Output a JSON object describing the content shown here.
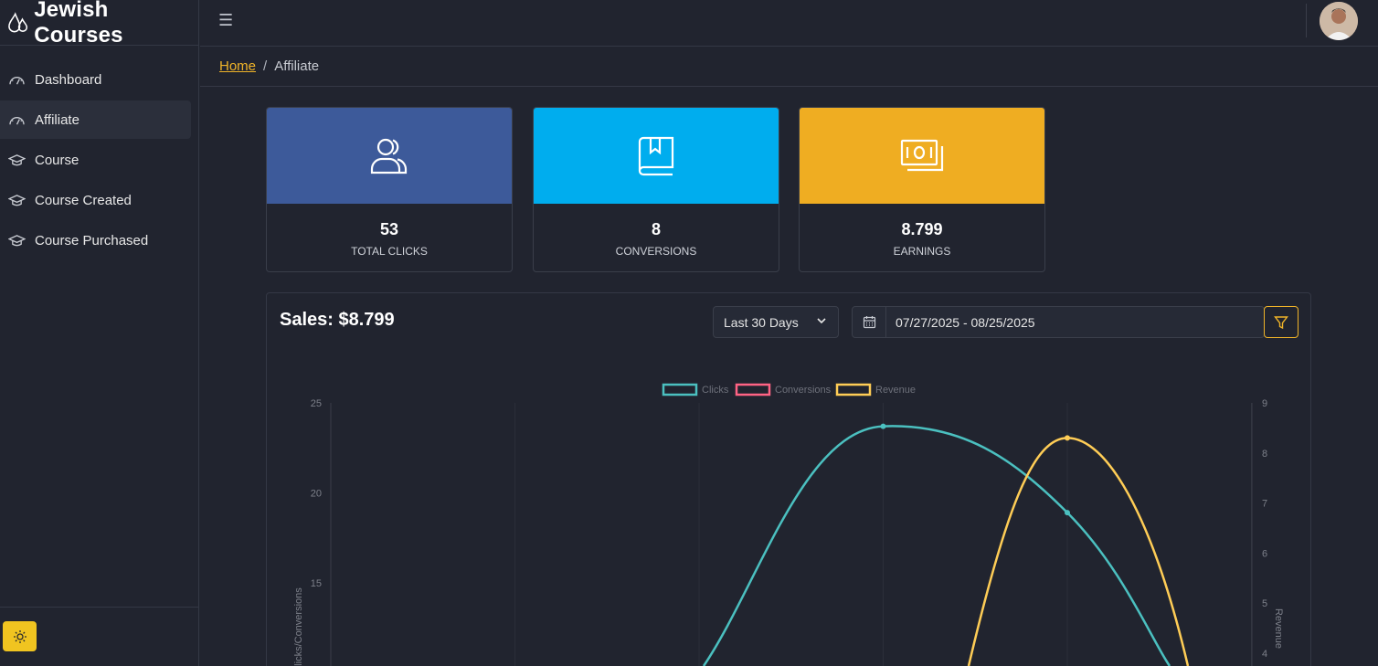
{
  "brand": {
    "name": "Jewish Courses"
  },
  "sidebar": {
    "items": [
      {
        "label": "Dashboard",
        "icon": "speedometer-icon",
        "active": false
      },
      {
        "label": "Affiliate",
        "icon": "speedometer-icon",
        "active": true
      },
      {
        "label": "Course",
        "icon": "graduation-cap-icon",
        "active": false
      },
      {
        "label": "Course Created",
        "icon": "graduation-cap-icon",
        "active": false
      },
      {
        "label": "Course Purchased",
        "icon": "graduation-cap-icon",
        "active": false
      }
    ],
    "theme_toggle_icon": "sun-icon"
  },
  "topbar": {
    "menu_icon": "hamburger-icon",
    "avatar": "user-avatar"
  },
  "breadcrumb": {
    "home": "Home",
    "separator": "/",
    "current": "Affiliate"
  },
  "stats": [
    {
      "value": "53",
      "label": "TOTAL CLICKS",
      "color": "#3d5a9a",
      "icon": "users-icon"
    },
    {
      "value": "8",
      "label": "CONVERSIONS",
      "color": "#00adee",
      "icon": "book-icon"
    },
    {
      "value": "8.799",
      "label": "EARNINGS",
      "color": "#efad22",
      "icon": "money-icon"
    }
  ],
  "sales": {
    "title": "Sales: $8.799",
    "range_select": "Last 30 Days",
    "date_range": "07/27/2025 - 08/25/2025",
    "filter_icon": "filter-icon",
    "calendar_icon": "calendar-icon"
  },
  "chart_data": {
    "type": "line",
    "legend_position": "top-center",
    "grid": true,
    "series": [
      {
        "name": "Clicks",
        "color": "#4bc0c0",
        "axis": "left",
        "points": [
          [
            3,
            23.7
          ],
          [
            4,
            18.9
          ]
        ]
      },
      {
        "name": "Conversions",
        "color": "#ff6384",
        "axis": "left",
        "points": []
      },
      {
        "name": "Revenue",
        "color": "#ffcd56",
        "axis": "right",
        "points": [
          [
            4,
            8.3
          ]
        ]
      }
    ],
    "y_left": {
      "label": "Clicks/Conversions",
      "ticks": [
        25,
        20,
        15
      ]
    },
    "y_right": {
      "label": "Revenue",
      "ticks": [
        9,
        8,
        7,
        6,
        5,
        4
      ]
    }
  }
}
